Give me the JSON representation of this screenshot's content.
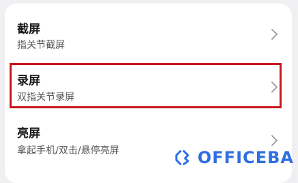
{
  "settings": {
    "items": [
      {
        "title": "截屏",
        "subtitle": "指关节截屏",
        "icon": "chevron-right-icon"
      },
      {
        "title": "录屏",
        "subtitle": "双指关节录屏",
        "icon": "chevron-right-icon"
      },
      {
        "title": "亮屏",
        "subtitle": "拿起手机/双击/悬停亮屏",
        "icon": "chevron-right-icon"
      }
    ],
    "highlight_color": "#c8161d"
  },
  "watermark": {
    "text": "OFFICEBA",
    "color": "#2f6fe0"
  }
}
